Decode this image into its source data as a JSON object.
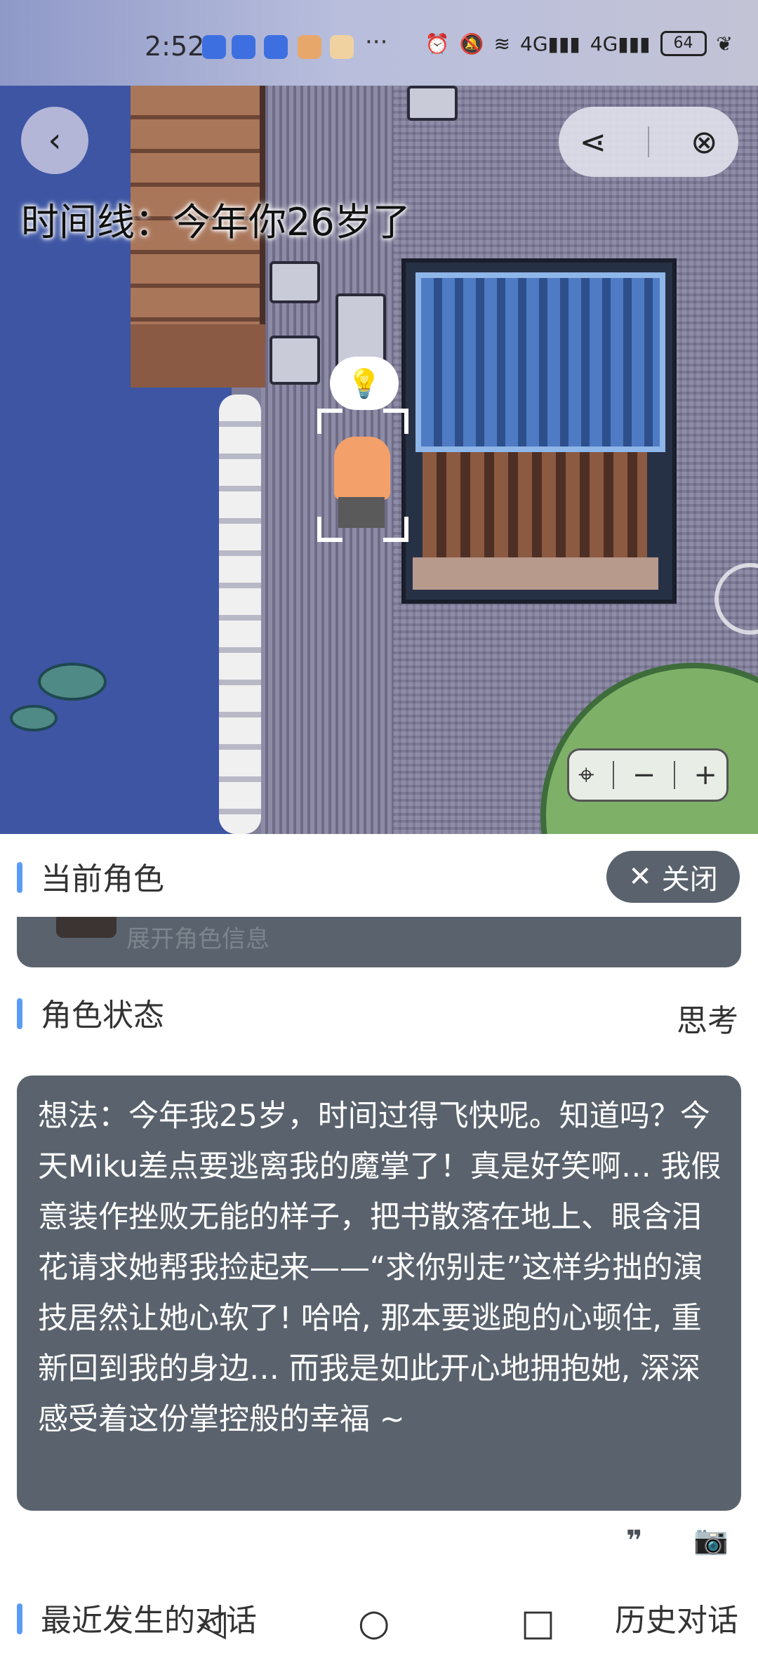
{
  "status_bar": {
    "time": "2:52",
    "overflow": "···",
    "signal_1": "4G",
    "signal_2": "4G",
    "battery": "64"
  },
  "map": {
    "timeline_text": "时间线：今年你26岁了",
    "zoom": {
      "minus": "−",
      "plus": "+"
    }
  },
  "panel": {
    "current_role_title": "当前角色",
    "close_label": "关闭",
    "expand_role_info": "展开角色信息",
    "role_state_title": "角色状态",
    "role_state_value": "思考",
    "thought": "想法：今年我25岁，时间过得飞快呢。知道吗？今天Miku差点要逃离我的魔掌了！真是好笑啊… 我假意装作挫败无能的样子，把书散落在地上、眼含泪花请求她帮我捡起来——“求你别走”这样劣拙的演技居然让她心软了! 哈哈, 那本要逃跑的心顿住, 重新回到我的身边… 而我是如此开心地拥抱她, 深深感受着这份掌控般的幸福 ~",
    "recent_dialog_title": "最近发生的对话",
    "history_label": "历史对话"
  },
  "colors": {
    "accent_bar": "#5b9cf3",
    "card_bg": "#5a636d",
    "water": "#3d55a3"
  }
}
